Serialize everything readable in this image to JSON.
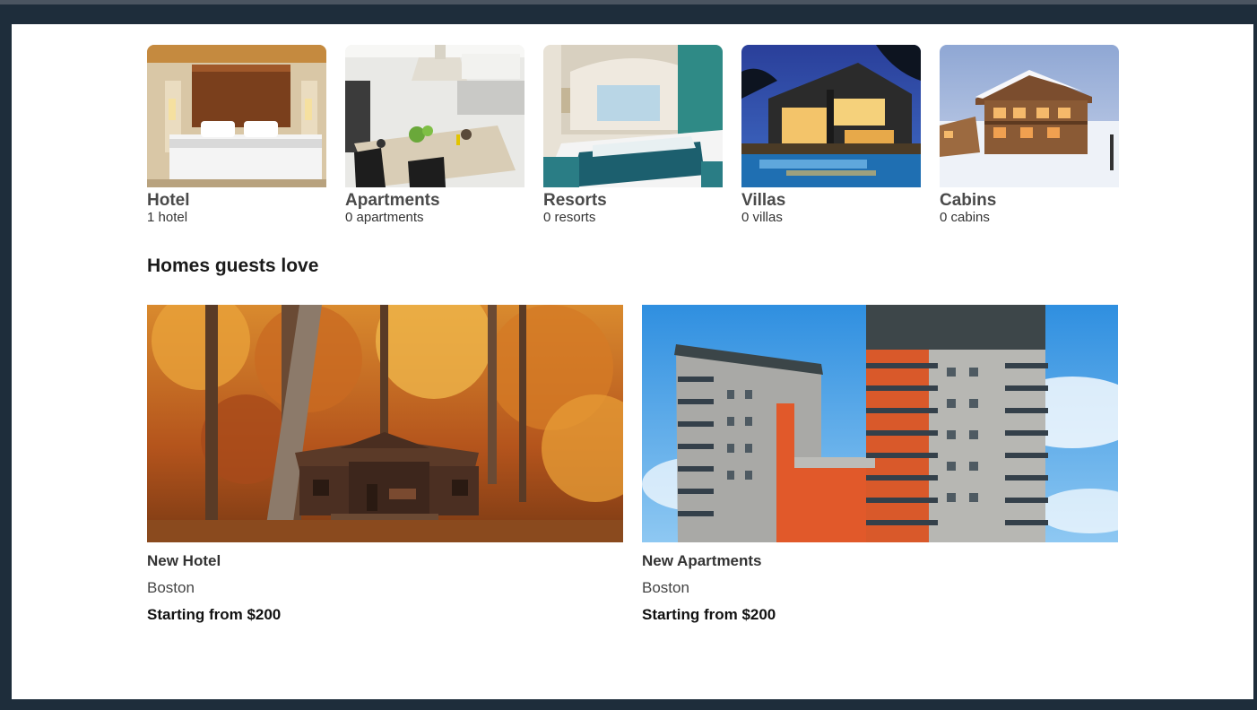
{
  "categories": [
    {
      "name": "Hotel",
      "count": "1 hotel",
      "icon": "hotel-bedroom-photo"
    },
    {
      "name": "Apartments",
      "count": "0 apartments",
      "icon": "apartment-kitchen-photo"
    },
    {
      "name": "Resorts",
      "count": "0 resorts",
      "icon": "resort-room-photo"
    },
    {
      "name": "Villas",
      "count": "0 villas",
      "icon": "villa-pool-photo"
    },
    {
      "name": "Cabins",
      "count": "0 cabins",
      "icon": "snowy-cabin-photo"
    }
  ],
  "homes_section": {
    "title": "Homes guests love",
    "items": [
      {
        "name": "New Hotel",
        "city": "Boston",
        "price": "Starting from $200",
        "icon": "autumn-cabin-photo"
      },
      {
        "name": "New Apartments",
        "city": "Boston",
        "price": "Starting from $200",
        "icon": "apartment-building-photo"
      }
    ]
  },
  "colors": {
    "frame": "#1e2d3b",
    "page": "#ffffff",
    "heading": "#1a1a1a"
  }
}
